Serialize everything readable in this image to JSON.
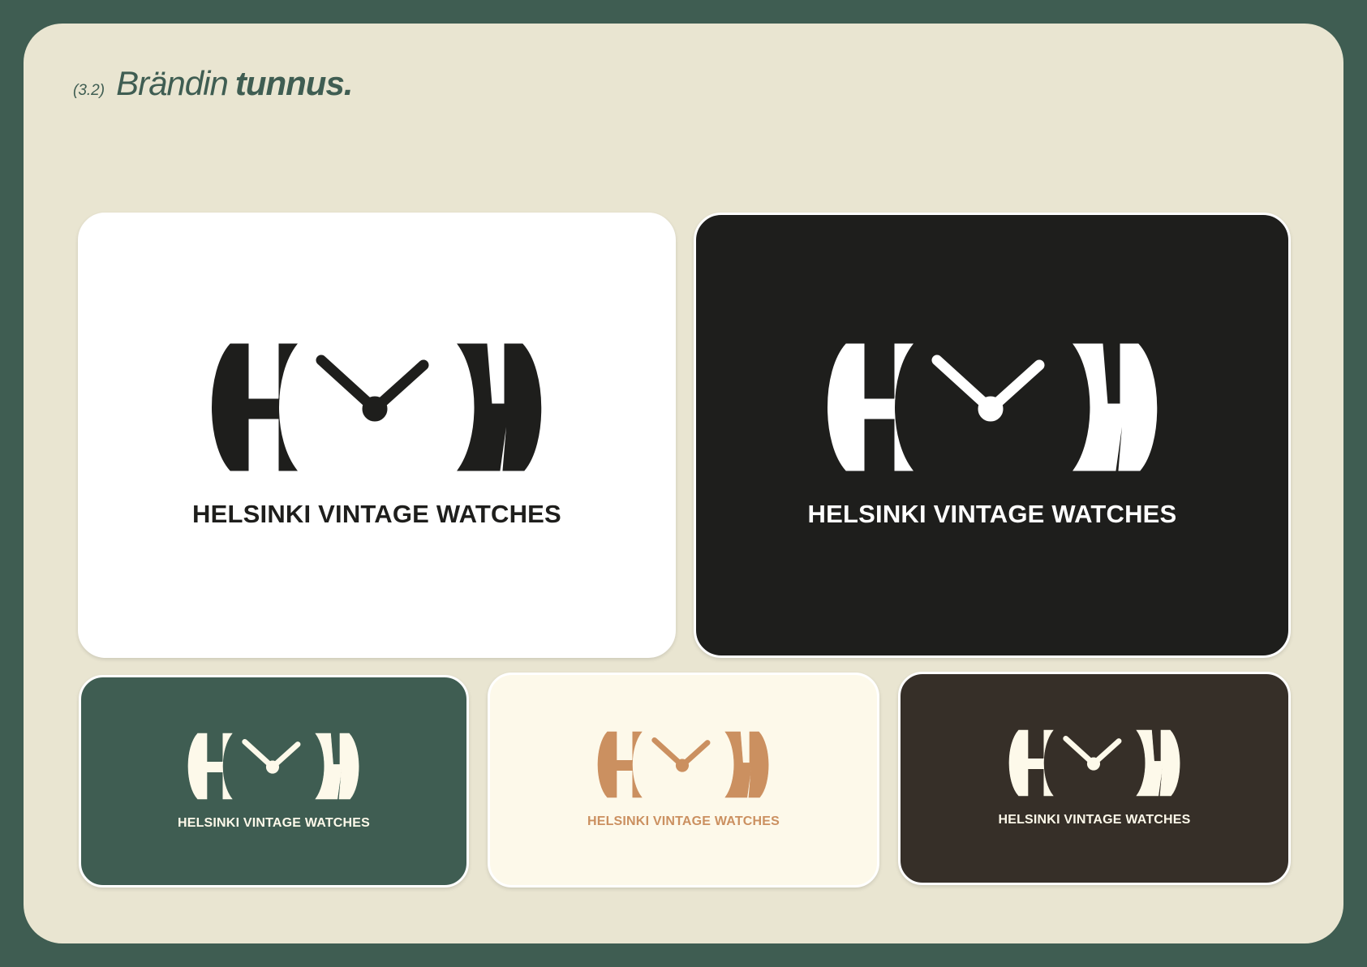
{
  "heading": {
    "number": "(3.2)",
    "title_light": "Brändin",
    "title_bold": "tunnus."
  },
  "colors": {
    "frame": "#3f5d52",
    "sheet": "#e9e5d1",
    "black": "#1e1e1c",
    "white": "#ffffff",
    "cream": "#fdf9ea",
    "copper": "#cb9060",
    "espresso": "#362f28"
  },
  "variants": [
    {
      "name": "white",
      "background": "#ffffff",
      "logo_color": "#1e1e1c",
      "wordmark": "HELSINKI VINTAGE WATCHES"
    },
    {
      "name": "black",
      "background": "#1e1e1c",
      "logo_color": "#ffffff",
      "wordmark": "HELSINKI VINTAGE WATCHES"
    },
    {
      "name": "green",
      "background": "#3f5d52",
      "logo_color": "#fdf9ea",
      "wordmark": "HELSINKI VINTAGE WATCHES"
    },
    {
      "name": "cream",
      "background": "#fdf9ea",
      "logo_color": "#cb9060",
      "wordmark": "HELSINKI VINTAGE WATCHES"
    },
    {
      "name": "espresso",
      "background": "#362f28",
      "logo_color": "#fdf9ea",
      "wordmark": "HELSINKI VINTAGE WATCHES"
    }
  ],
  "logo_icon": "hvw-clock-monogram-icon"
}
